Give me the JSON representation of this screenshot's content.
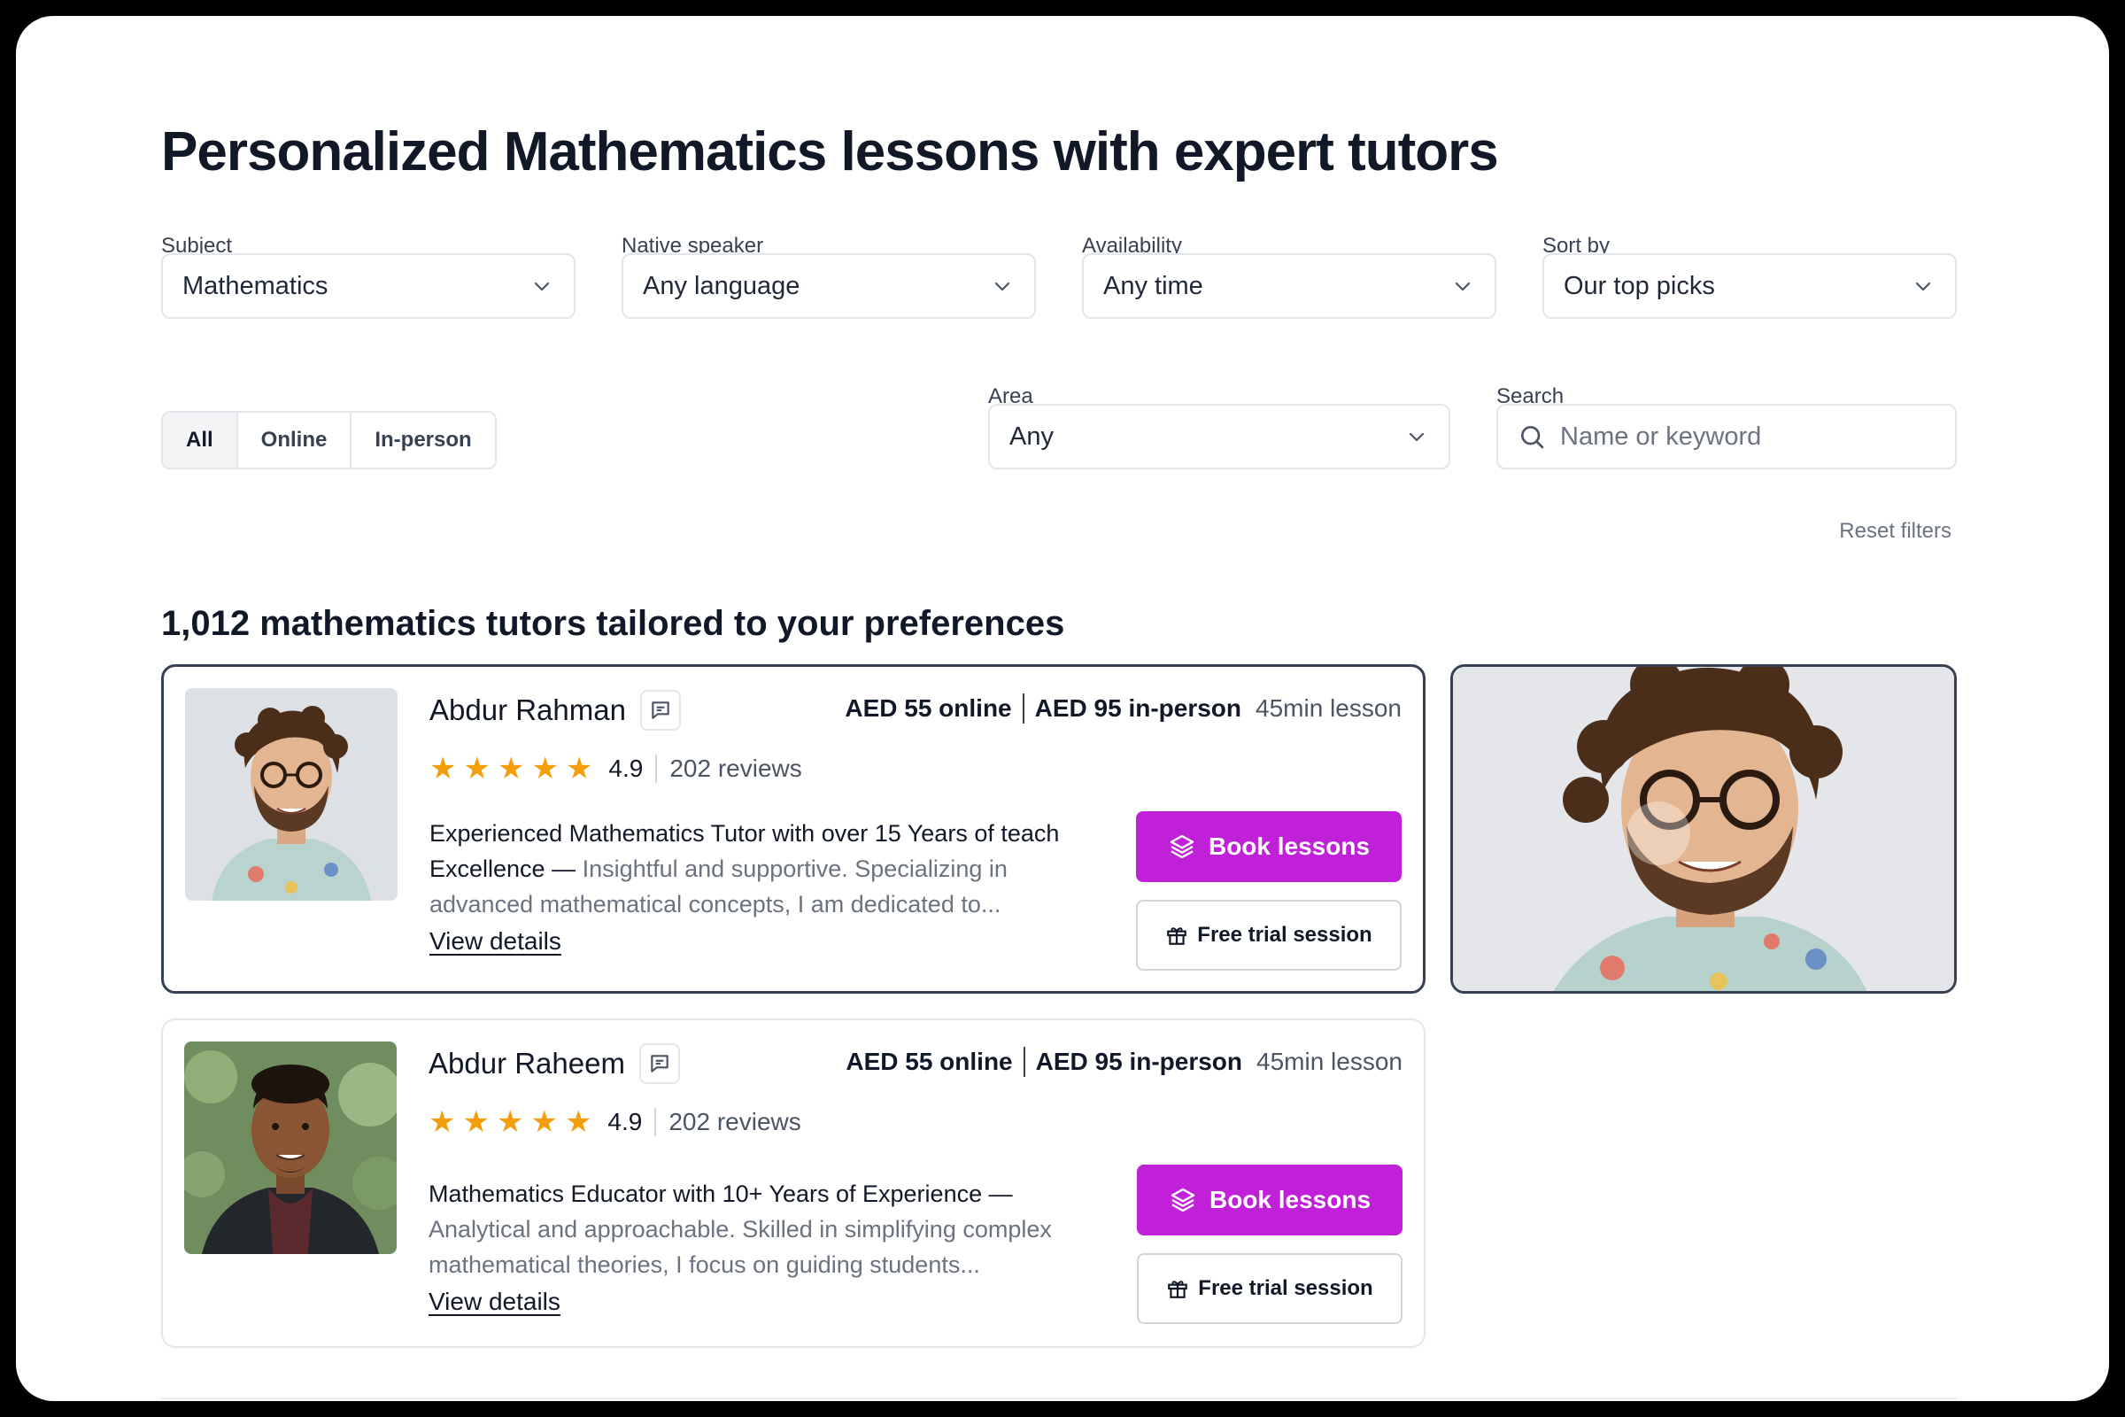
{
  "page": {
    "title": "Personalized Mathematics lessons with expert tutors"
  },
  "filters": {
    "subject": {
      "label": "Subject",
      "value": "Mathematics"
    },
    "native_speaker": {
      "label": "Native speaker",
      "value": "Any language"
    },
    "availability": {
      "label": "Availability",
      "value": "Any time"
    },
    "sort_by": {
      "label": "Sort by",
      "value": "Our top picks"
    },
    "mode_tabs": [
      {
        "label": "All",
        "active": true
      },
      {
        "label": "Online",
        "active": false
      },
      {
        "label": "In-person",
        "active": false
      }
    ],
    "area": {
      "label": "Area",
      "value": "Any"
    },
    "search": {
      "label": "Search",
      "placeholder": "Name or keyword"
    },
    "reset_label": "Reset filters"
  },
  "results": {
    "heading": "1,012 mathematics tutors tailored to your preferences",
    "tutors": [
      {
        "name": "Abdur Rahman",
        "price_online": "AED 55 online",
        "price_inperson": "AED 95 in-person",
        "duration": "45min lesson",
        "rating": "4.9",
        "stars": 5,
        "reviews": "202 reviews",
        "headline": "Experienced Mathematics Tutor with over 15 Years of teach Excellence —",
        "description": " Insightful and supportive. Specializing in advanced mathematical concepts, I am dedicated to...",
        "view_details": "View details",
        "book_label": "Book lessons",
        "trial_label": "Free trial session",
        "selected": true
      },
      {
        "name": "Abdur Raheem",
        "price_online": "AED 55 online",
        "price_inperson": "AED 95 in-person",
        "duration": "45min lesson",
        "rating": "4.9",
        "stars": 5,
        "reviews": "202 reviews",
        "headline": "Mathematics Educator with 10+ Years of Experience —",
        "description": " Analytical and approachable. Skilled in simplifying complex mathematical theories, I focus on guiding students...",
        "view_details": "View details",
        "book_label": "Book lessons",
        "trial_label": "Free trial session",
        "selected": false
      }
    ]
  },
  "colors": {
    "accent": "#c020d8",
    "star": "#f59e0b",
    "text_primary": "#111827",
    "text_muted": "#6b7280"
  },
  "icons": [
    "chevron-down-icon",
    "search-icon",
    "chat-icon",
    "star-icon",
    "layers-icon",
    "gift-icon"
  ]
}
